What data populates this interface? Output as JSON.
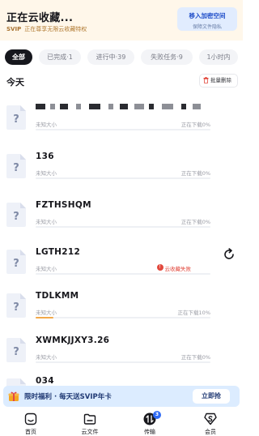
{
  "header": {
    "title": "正在云收藏...",
    "vip_badge": "SVIP",
    "subtitle": "正在尊享无限云收藏特权",
    "vault_title": "移入加密空间",
    "vault_subtitle": "保障文件隐私"
  },
  "tabs": [
    {
      "label": "全部",
      "active": true
    },
    {
      "label": "已完成·1",
      "active": false
    },
    {
      "label": "进行中·39",
      "active": false
    },
    {
      "label": "失败任务·9",
      "active": false
    },
    {
      "label": "1小时内",
      "active": false
    }
  ],
  "section": {
    "title": "今天",
    "batch_delete": "批量删除"
  },
  "items": [
    {
      "name": "",
      "size": "未知大小",
      "status": "正在下载0%",
      "progress": 0,
      "blurred": true
    },
    {
      "name": "136",
      "size": "未知大小",
      "status": "正在下载0%",
      "progress": 0
    },
    {
      "name": "FZTHSHQM",
      "size": "未知大小",
      "status": "正在下载0%",
      "progress": 0
    },
    {
      "name": "LGTH212",
      "size": "未知大小",
      "status": "云收藏失败",
      "error": true,
      "progress": 0
    },
    {
      "name": "TDLKMM",
      "size": "未知大小",
      "status": "正在下载10%",
      "progress": 0.1
    },
    {
      "name": "XWMKJJXY3.26",
      "size": "未知大小",
      "status": "正在下载0%",
      "progress": 0
    },
    {
      "name": "034",
      "size": "",
      "status": "",
      "progress": 0
    }
  ],
  "promo": {
    "text": "限时福利 · 每天送SVIP年卡",
    "button": "立即抢"
  },
  "nav": [
    {
      "label": "首页",
      "icon": "home-icon"
    },
    {
      "label": "云文件",
      "icon": "folder-icon"
    },
    {
      "label": "传输",
      "icon": "transfer-icon",
      "badge": "3"
    },
    {
      "label": "会员",
      "icon": "vip-icon"
    }
  ],
  "colors": {
    "accent": "#2f6bf5",
    "error": "#e2483d",
    "progress": "#f2a94a",
    "banner_bg": "#fff7ea"
  }
}
